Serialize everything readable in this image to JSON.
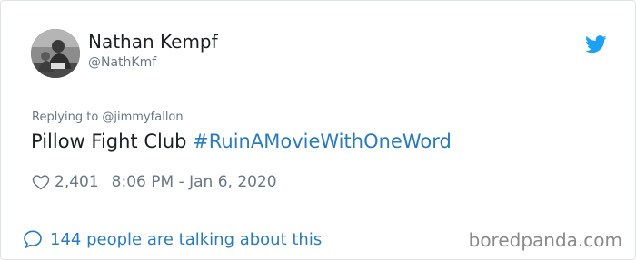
{
  "author": {
    "display_name": "Nathan Kempf",
    "handle": "@NathKmf",
    "avatar_icon": "user-avatar-photo"
  },
  "icons": {
    "brand": "twitter-bird-icon",
    "like": "heart-outline-icon",
    "conversation": "speech-bubble-icon"
  },
  "colors": {
    "link_blue": "#2b7bb9",
    "twitter_blue": "#1da1f2",
    "muted_gray": "#697882",
    "text_dark": "#1c2022"
  },
  "tweet": {
    "reply_to": "Replying to @jimmyfallon",
    "text_plain": "Pillow Fight Club",
    "hashtag": "#RuinAMovieWithOneWord",
    "likes": "2,401",
    "timestamp": "8:06 PM - Jan 6, 2020"
  },
  "footer": {
    "conversation_link": "144 people are talking about this"
  },
  "watermark": "boredpanda.com"
}
